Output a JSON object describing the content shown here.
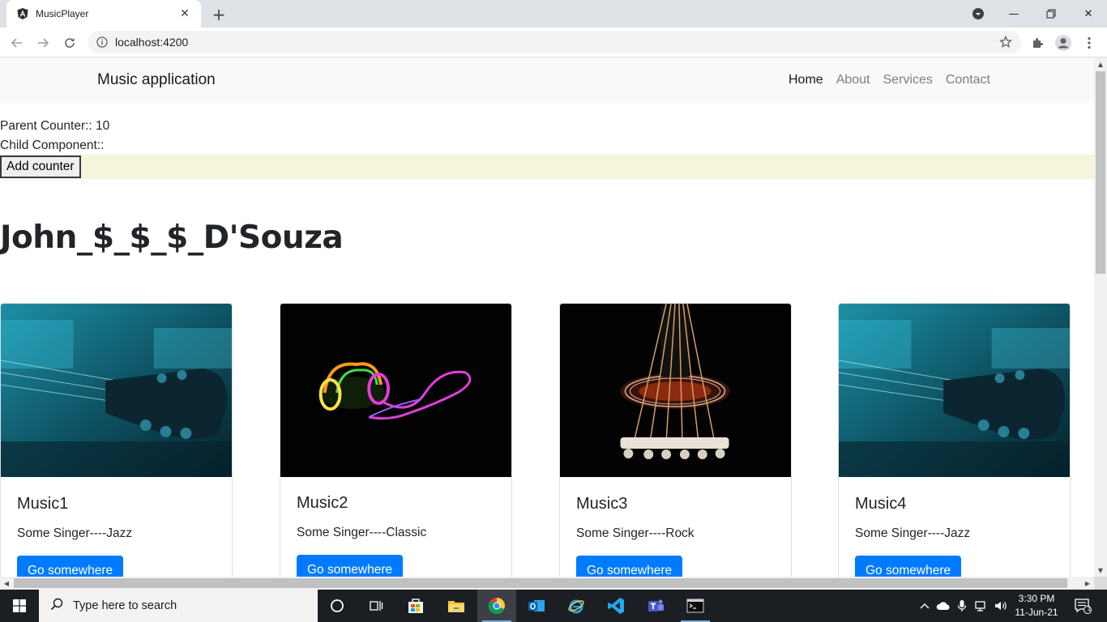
{
  "browser": {
    "tab_title": "MusicPlayer",
    "url": "localhost:4200"
  },
  "app": {
    "brand": "Music application",
    "nav": [
      "Home",
      "About",
      "Services",
      "Contact"
    ],
    "active_nav": "Home",
    "parent_counter_label": "Parent Counter:: 10",
    "child_component_label": "Child Component::",
    "add_counter_label": "Add counter",
    "heading": "John_$_$_$_D'Souza",
    "cards": [
      {
        "title": "Music1",
        "text": "Some Singer----Jazz",
        "button": "Go somewhere",
        "image": "guitar-headstock-blue"
      },
      {
        "title": "Music2",
        "text": "Some Singer----Classic",
        "button": "Go somewhere",
        "image": "neon-headphones"
      },
      {
        "title": "Music3",
        "text": "Some Singer----Rock",
        "button": "Go somewhere",
        "image": "acoustic-guitar-dark"
      },
      {
        "title": "Music4",
        "text": "Some Singer----Jazz",
        "button": "Go somewhere",
        "image": "guitar-headstock-blue"
      }
    ]
  },
  "taskbar": {
    "search_placeholder": "Type here to search",
    "time": "3:30 PM",
    "date": "11-Jun-21",
    "notification_count": "1"
  },
  "colors": {
    "primary_button": "#007bff",
    "navbar_bg": "#f8f9fa",
    "counter_band": "#f5f5dc",
    "taskbar_bg": "#1b1f24"
  }
}
